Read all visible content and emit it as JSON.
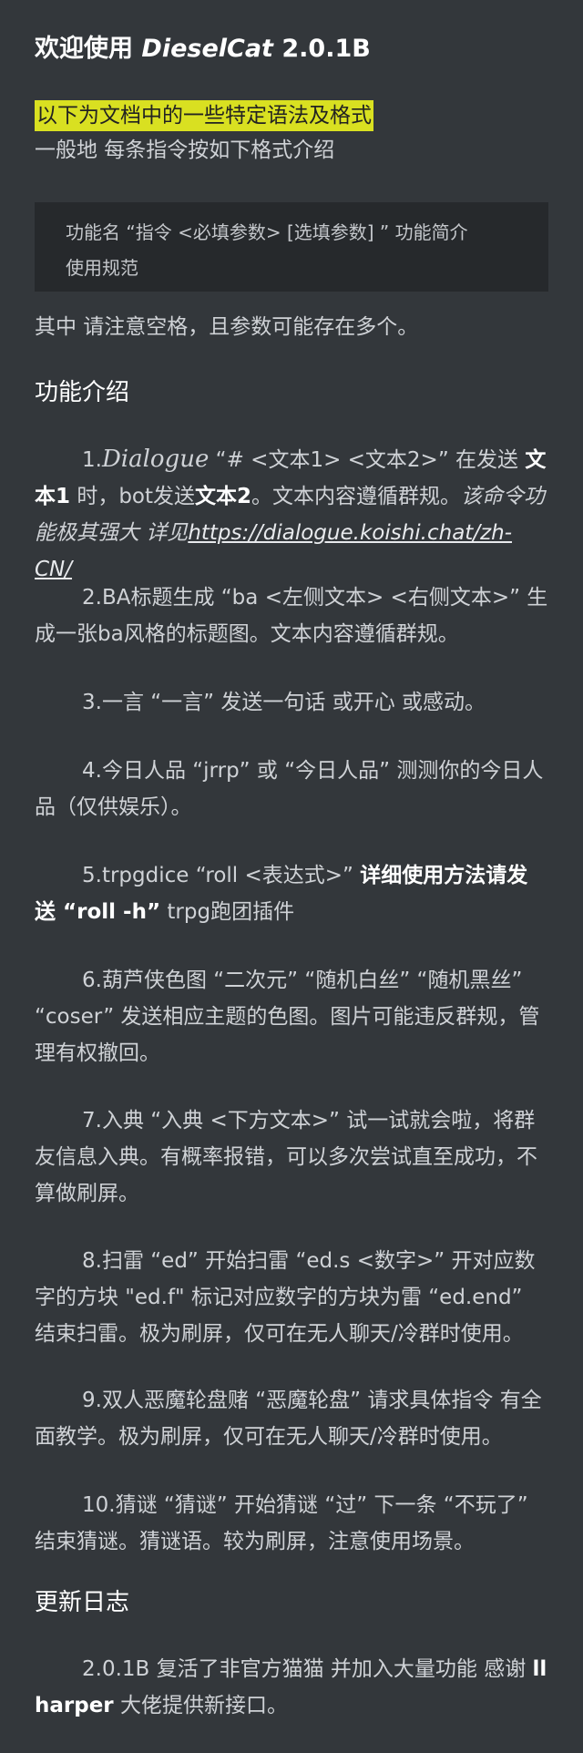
{
  "title": {
    "prefix": "欢迎使用 ",
    "brand": "DieselCat",
    "version": " 2.0.1B"
  },
  "highlight": "以下为文档中的一些特定语法及格式",
  "intro": "一般地 每条指令按如下格式介绍",
  "codebox": {
    "line1": "功能名 “指令 <必填参数> [选填参数] ” 功能简介",
    "line2": "使用规范"
  },
  "note": "其中 请注意空格，且参数可能存在多个。",
  "features_heading": "功能介绍",
  "f1": {
    "num": "1.",
    "name": "Dialogue",
    "t1": " “# <文本1> <文本2>” 在发送 ",
    "b1": "文本1",
    "t2": " 时，bot发送",
    "b2": "文本2",
    "t3": "。文本内容遵循群规。",
    "em": "该命令功能极其强大 详见",
    "link": "https://dialogue.koishi.chat/zh-CN/"
  },
  "f2": "2.BA标题生成 “ba <左侧文本> <右侧文本>” 生成一张ba风格的标题图。文本内容遵循群规。",
  "f3": "3.一言 “一言” 发送一句话 或开心 或感动。",
  "f4": "4.今日人品 “jrrp” 或 “今日人品” 测测你的今日人品（仅供娱乐）。",
  "f5": {
    "t1": "5.trpgdice “roll <表达式>” ",
    "b1": "详细使用方法请发送 “roll -h”",
    "t2": " trpg跑团插件"
  },
  "f6": "6.葫芦侠色图 “二次元” “随机白丝” “随机黑丝” “coser” 发送相应主题的色图。图片可能违反群规，管理有权撤回。",
  "f7": "7.入典 “入典 <下方文本>” 试一试就会啦，将群友信息入典。有概率报错，可以多次尝试直至成功，不算做刷屏。",
  "f8": "8.扫雷 “ed” 开始扫雷 “ed.s <数字>” 开对应数字的方块 \"ed.f\" 标记对应数字的方块为雷 “ed.end” 结束扫雷。极为刷屏，仅可在无人聊天/冷群时使用。",
  "f9": "9.双人恶魔轮盘赌 “恶魔轮盘” 请求具体指令 有全面教学。极为刷屏，仅可在无人聊天/冷群时使用。",
  "f10": "10.猜谜 “猜谜” 开始猜谜 “过” 下一条 “不玩了” 结束猜谜。猜谜语。较为刷屏，注意使用场景。",
  "changelog_heading": "更新日志",
  "changelog": {
    "t1": "2.0.1B 复活了非官方猫猫 并加入大量功能 感谢 ",
    "b1": "ll harper",
    "t2": " 大佬提供新接口。"
  }
}
